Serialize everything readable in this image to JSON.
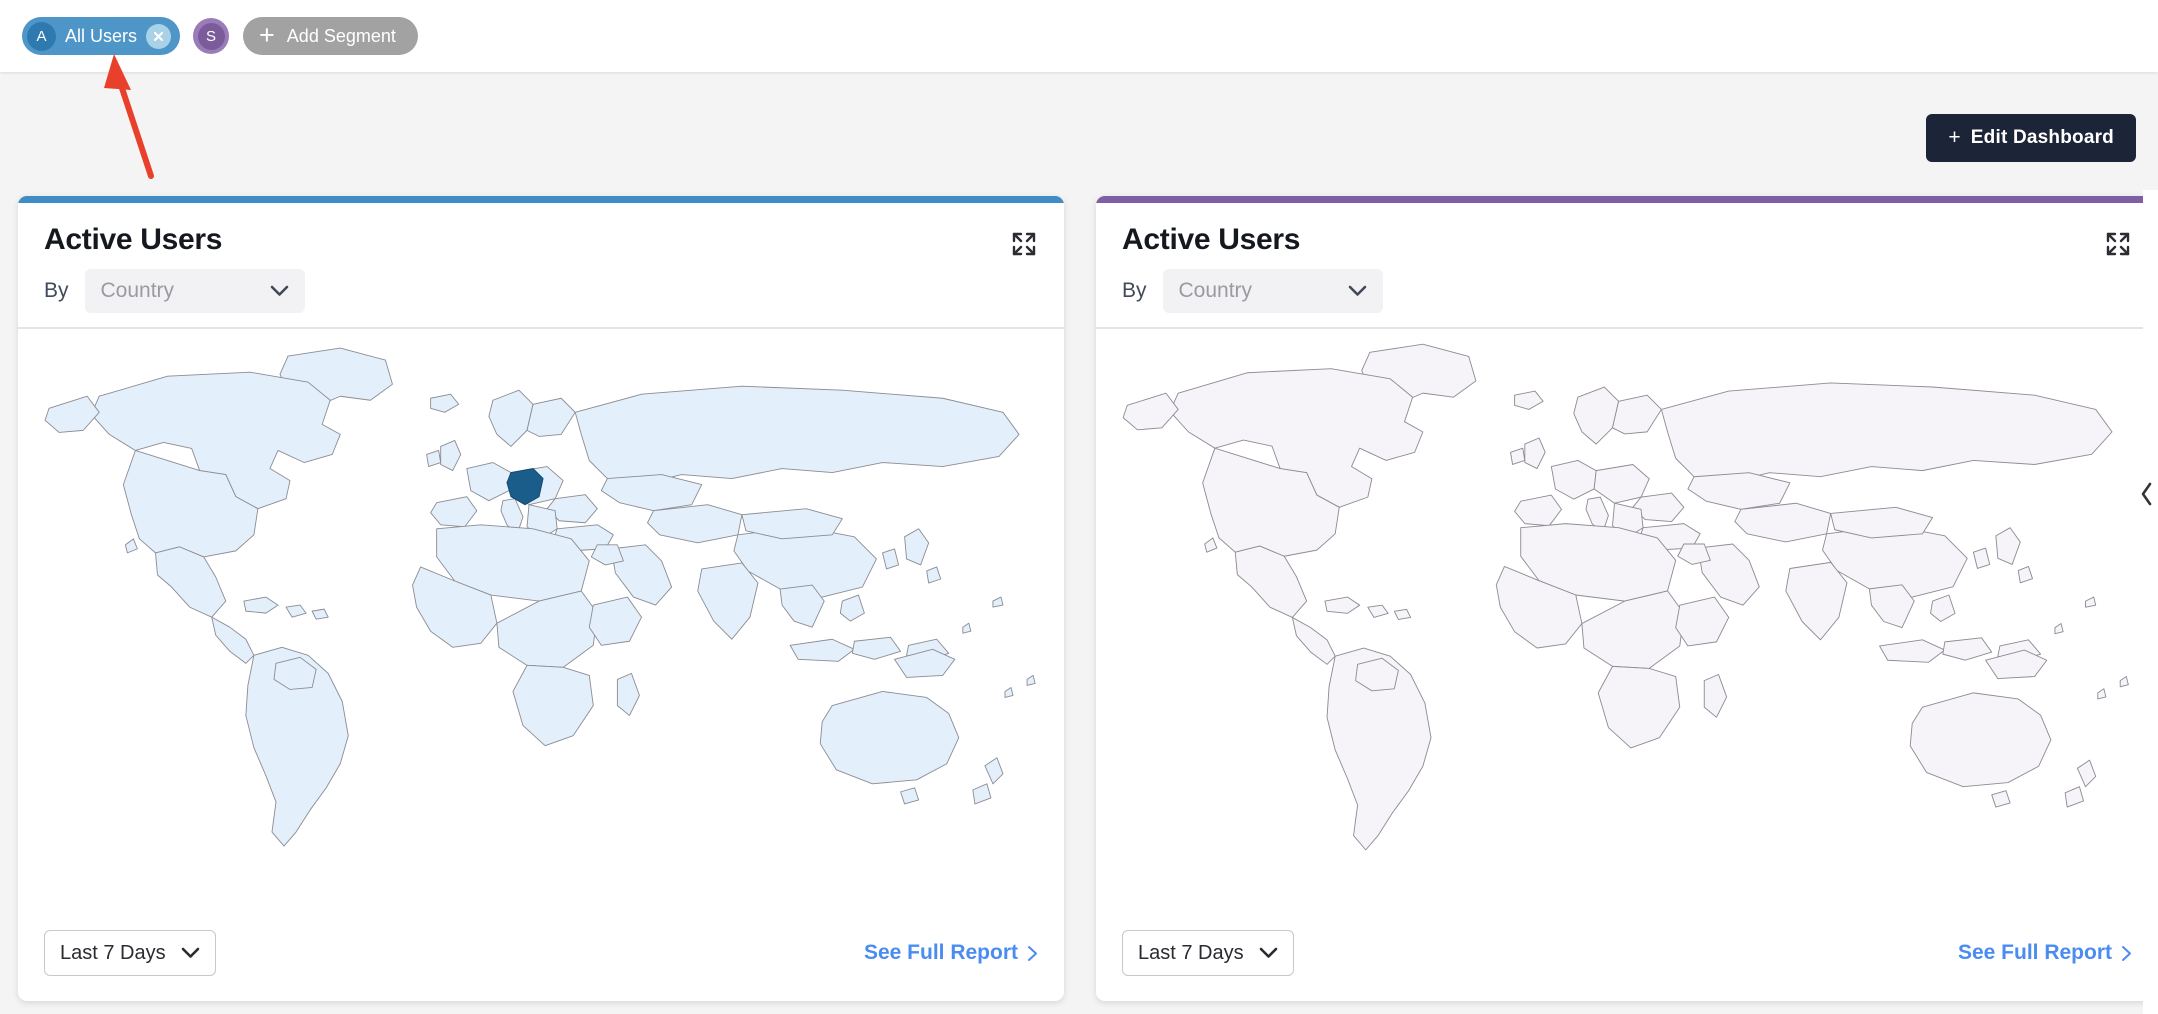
{
  "segment_bar": {
    "segments": [
      {
        "initial": "A",
        "label": "All Users",
        "close_icon": "close-x-icon",
        "color": "#4e95c8",
        "active": true
      }
    ],
    "user_avatar": {
      "initial": "S",
      "color": "#7c5b9b"
    },
    "add_segment": {
      "label": "Add Segment",
      "icon": "plus-icon",
      "color": "#a2a2a2"
    }
  },
  "toolbar": {
    "edit_dashboard_label": "Edit Dashboard",
    "edit_dashboard_icon": "plus-icon",
    "edit_dashboard_color": "#1c2438"
  },
  "cards": [
    {
      "title": "Active Users",
      "accent_color": "#3f8dc4",
      "by_label": "By",
      "dimension_value": "Country",
      "dimension_placeholder": "Country",
      "expand_icon": "expand-fullscreen-icon",
      "chevron_icon": "chevron-down-icon",
      "date_range": "Last 7 Days",
      "report_link_label": "See Full Report",
      "report_link_icon": "chevron-right-icon",
      "map": {
        "fill": "#e3effa",
        "stroke": "#8c8c94",
        "highlight_country": "Germany",
        "highlight_fill": "#1a5c8a"
      }
    },
    {
      "title": "Active Users",
      "accent_color": "#7f5fa4",
      "by_label": "By",
      "dimension_value": "Country",
      "dimension_placeholder": "Country",
      "expand_icon": "expand-fullscreen-icon",
      "chevron_icon": "chevron-down-icon",
      "date_range": "Last 7 Days",
      "report_link_label": "See Full Report",
      "report_link_icon": "chevron-right-icon",
      "map": {
        "fill": "#f6f3f9",
        "stroke": "#8c8c94",
        "highlight_country": null,
        "highlight_fill": null
      }
    }
  ],
  "right_panel": {
    "collapse_icon": "chevron-left-icon"
  },
  "annotation": {
    "arrow_color": "#e8402a",
    "points_to": "All Users segment pill"
  },
  "colors": {
    "page_background": "#f4f4f4",
    "card_background": "#ffffff",
    "link_blue": "#4a8cf0",
    "accent_blue": "#3f8dc4",
    "accent_purple": "#7f5fa4",
    "dark_navy": "#1c2438"
  }
}
